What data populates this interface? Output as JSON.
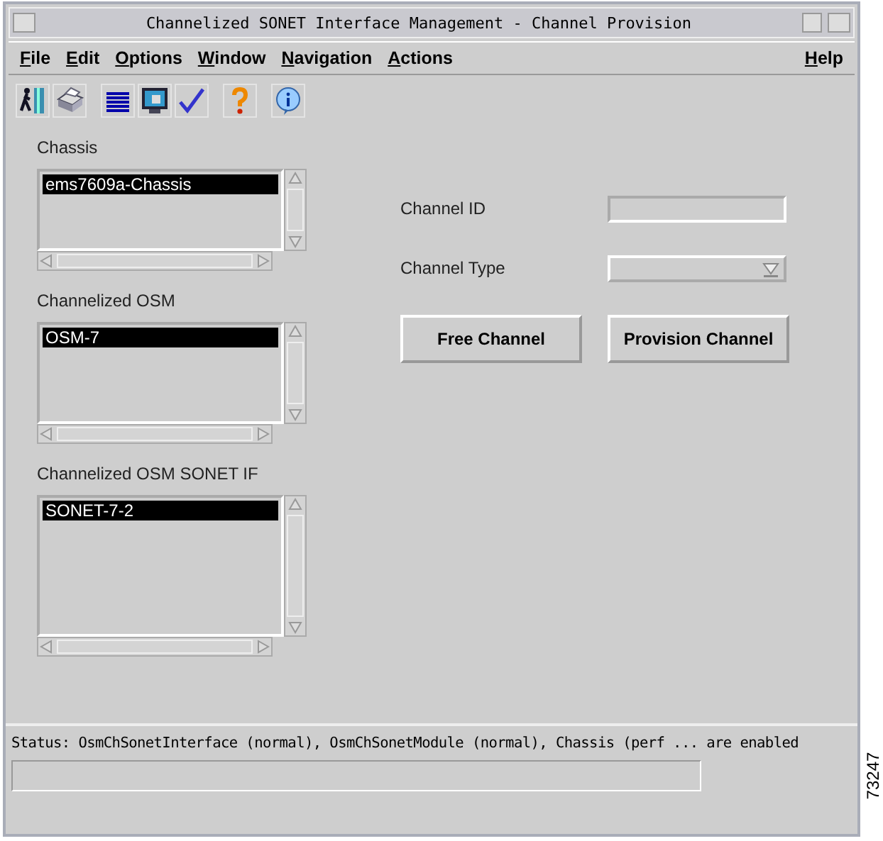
{
  "window": {
    "title": "Channelized SONET Interface Management - Channel Provision"
  },
  "menu": [
    {
      "label": "File"
    },
    {
      "label": "Edit"
    },
    {
      "label": "Options"
    },
    {
      "label": "Window"
    },
    {
      "label": "Navigation"
    },
    {
      "label": "Actions"
    }
  ],
  "help_menu": {
    "label": "Help"
  },
  "lists": [
    {
      "label": "Chassis",
      "items": [
        {
          "text": "ems7609a-Chassis",
          "selected": true
        }
      ]
    },
    {
      "label": "Channelized OSM",
      "items": [
        {
          "text": "OSM-7",
          "selected": true
        }
      ]
    },
    {
      "label": "Channelized OSM SONET IF",
      "items": [
        {
          "text": "SONET-7-2",
          "selected": true
        }
      ]
    }
  ],
  "fields": [
    {
      "label": "Channel ID",
      "kind": "text"
    },
    {
      "label": "Channel Type",
      "kind": "dropdown"
    }
  ],
  "buttons": [
    {
      "label": "Free Channel"
    },
    {
      "label": "Provision Channel"
    }
  ],
  "status": "Status: OsmChSonetInterface (normal), OsmChSonetModule (normal), Chassis (perf ... are enabled",
  "figure_id": "73247"
}
